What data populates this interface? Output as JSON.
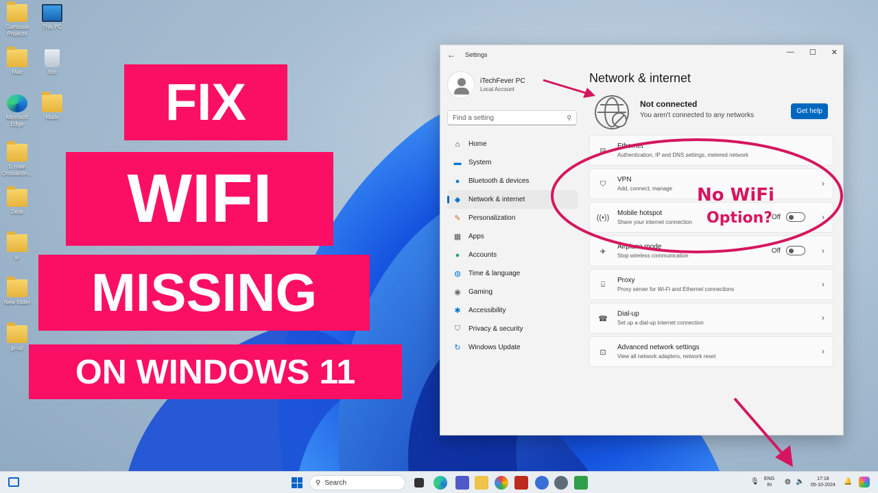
{
  "desktop": {
    "icons": [
      {
        "label": "Camtasia Projects",
        "icon": "folder-icon"
      },
      {
        "label": "This PC",
        "icon": "computer-icon"
      },
      {
        "label": "Mac",
        "icon": "folder-icon"
      },
      {
        "label": "Bin",
        "icon": "recycle-bin-icon"
      },
      {
        "label": "Microsoft Edge",
        "icon": "edge-icon"
      },
      {
        "label": "Mails",
        "icon": "folder-icon"
      },
      {
        "label": "1. main Onboardin...",
        "icon": "folder-icon"
      },
      {
        "label": "Desk",
        "icon": "folder-icon"
      },
      {
        "label": "jp",
        "icon": "folder-icon"
      },
      {
        "label": "New folder",
        "icon": "folder-icon"
      },
      {
        "label": "jp-up",
        "icon": "folder-icon"
      }
    ]
  },
  "banner": {
    "line1": "FIX",
    "line2": "WIFI",
    "line3": "MISSING",
    "line4": "ON WINDOWS 11",
    "color": "#fb0f64"
  },
  "settings": {
    "title": "Settings",
    "profile": {
      "name": "iTechFever PC",
      "account": "Local Account"
    },
    "search_placeholder": "Find a setting",
    "nav": [
      {
        "label": "Home",
        "icon": "home-icon"
      },
      {
        "label": "System",
        "icon": "system-icon"
      },
      {
        "label": "Bluetooth & devices",
        "icon": "bluetooth-icon"
      },
      {
        "label": "Network & internet",
        "icon": "wifi-icon",
        "active": true
      },
      {
        "label": "Personalization",
        "icon": "brush-icon"
      },
      {
        "label": "Apps",
        "icon": "apps-icon"
      },
      {
        "label": "Accounts",
        "icon": "accounts-icon"
      },
      {
        "label": "Time & language",
        "icon": "globe-clock-icon"
      },
      {
        "label": "Gaming",
        "icon": "gamepad-icon"
      },
      {
        "label": "Accessibility",
        "icon": "accessibility-icon"
      },
      {
        "label": "Privacy & security",
        "icon": "shield-icon"
      },
      {
        "label": "Windows Update",
        "icon": "update-icon"
      }
    ],
    "page_title": "Network & internet",
    "status": {
      "title": "Not connected",
      "subtitle": "You aren't connected to any networks",
      "help_button": "Get help"
    },
    "cards": [
      {
        "title": "Ethernet",
        "subtitle": "Authentication, IP and DNS settings, metered network",
        "icon": "ethernet-icon"
      },
      {
        "title": "VPN",
        "subtitle": "Add, connect, manage",
        "icon": "vpn-shield-icon"
      },
      {
        "title": "Mobile hotspot",
        "subtitle": "Share your internet connection",
        "icon": "hotspot-icon",
        "toggle": "Off"
      },
      {
        "title": "Airplane mode",
        "subtitle": "Stop wireless communication",
        "icon": "airplane-icon",
        "toggle": "Off"
      },
      {
        "title": "Proxy",
        "subtitle": "Proxy server for Wi-Fi and Ethernet connections",
        "icon": "proxy-icon"
      },
      {
        "title": "Dial-up",
        "subtitle": "Set up a dial-up internet connection",
        "icon": "dialup-icon"
      },
      {
        "title": "Advanced network settings",
        "subtitle": "View all network adapters, network reset",
        "icon": "network-adapter-icon"
      }
    ]
  },
  "annotation": {
    "line1": "No WiFi",
    "line2": "Option?",
    "color": "#d5165f"
  },
  "taskbar": {
    "search_label": "Search",
    "lang_top": "ENG",
    "lang_bottom": "IN",
    "time": "17:18",
    "date": "05-10-2024"
  }
}
